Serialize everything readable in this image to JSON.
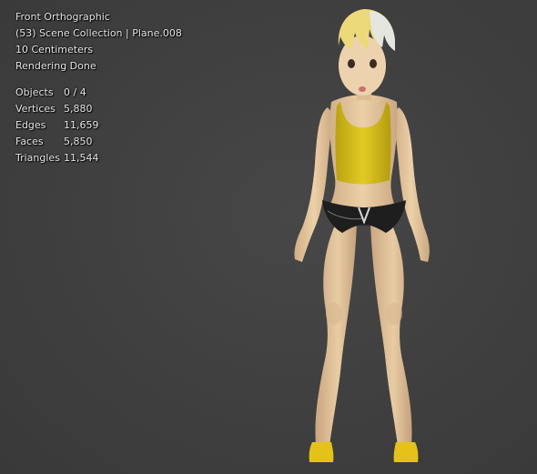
{
  "viewport": {
    "view_name": "Front Orthographic",
    "collection_info": "(53) Scene Collection | Plane.008",
    "grid_scale": "10 Centimeters",
    "render_status": "Rendering Done"
  },
  "statistics": [
    {
      "label": "Objects",
      "value": "0 / 4"
    },
    {
      "label": "Vertices",
      "value": "5,880"
    },
    {
      "label": "Edges",
      "value": "11,659"
    },
    {
      "label": "Faces",
      "value": "5,850"
    },
    {
      "label": "Triangles",
      "value": "11,544"
    }
  ],
  "colors": {
    "background": "#3f3f3f",
    "skin": "#e8c9a0",
    "hair": "#ecd97a",
    "top": "#d9c21c",
    "shorts": "#1e1e1e",
    "shoes": "#e4c21a",
    "overlay_text": "#e6e6e6"
  }
}
